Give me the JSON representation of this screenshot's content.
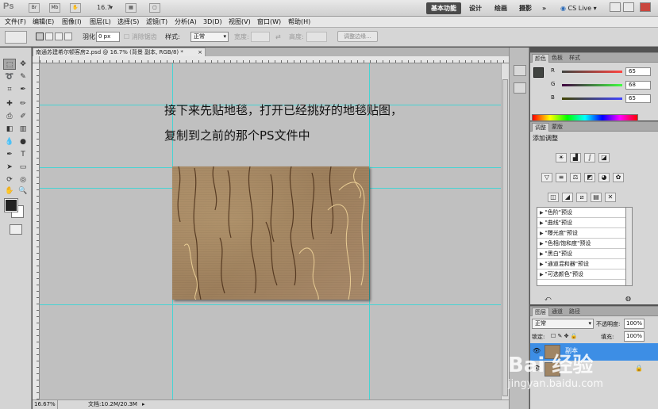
{
  "app": {
    "logo": "Ps",
    "zoom_value": "16.7"
  },
  "workspaces": {
    "active": "基本功能",
    "items": [
      "设计",
      "绘画",
      "摄影"
    ],
    "more": "»"
  },
  "cslive": {
    "label": "CS Live"
  },
  "menu": [
    "文件(F)",
    "编辑(E)",
    "图像(I)",
    "图层(L)",
    "选择(S)",
    "滤镜(T)",
    "分析(A)",
    "3D(D)",
    "视图(V)",
    "窗口(W)",
    "帮助(H)"
  ],
  "options": {
    "feather_label": "羽化:",
    "feather_value": "0 px",
    "antialias_label": "消除锯齿",
    "style_label": "样式:",
    "style_value": "正常",
    "width_label": "宽度:",
    "height_label": "高度:",
    "refine_button": "调整边缘..."
  },
  "document": {
    "tab_title": "南通苏建希尔顿客房2.psd @ 16.7% (背景 副本, RGB/8) *",
    "zoom": "16.67%",
    "doc_size": "文档:10.2M/20.3M"
  },
  "canvas_text": {
    "line1": "接下来先贴地毯，打开已经挑好的地毯贴图，",
    "line2": "复制到之前的那个PS文件中"
  },
  "color_panel": {
    "tabs": [
      "颜色",
      "色板",
      "样式"
    ],
    "channels": [
      {
        "name": "R",
        "value": "65",
        "color": "#d33"
      },
      {
        "name": "G",
        "value": "68",
        "color": "#3a3"
      },
      {
        "name": "B",
        "value": "65",
        "color": "#33d"
      }
    ]
  },
  "adjust_panel": {
    "tabs": [
      "调整",
      "蒙版"
    ],
    "title": "添加调整",
    "presets": [
      "\"色阶\"预设",
      "\"曲线\"预设",
      "\"曝光度\"预设",
      "\"色相/饱和度\"预设",
      "\"黑白\"预设",
      "\"通道混和器\"预设",
      "\"可选颜色\"预设"
    ]
  },
  "layers_panel": {
    "tabs": [
      "图层",
      "通道",
      "路径"
    ],
    "blend_mode": "正常",
    "opacity_label": "不透明度:",
    "opacity_value": "100%",
    "lock_label": "锁定:",
    "fill_label": "填充:",
    "fill_value": "100%",
    "layers": [
      {
        "name": "副本",
        "selected": true
      },
      {
        "name": "",
        "selected": false
      }
    ]
  },
  "watermark": {
    "brand": "Bai 经验",
    "url": "jingyan.baidu.com"
  }
}
